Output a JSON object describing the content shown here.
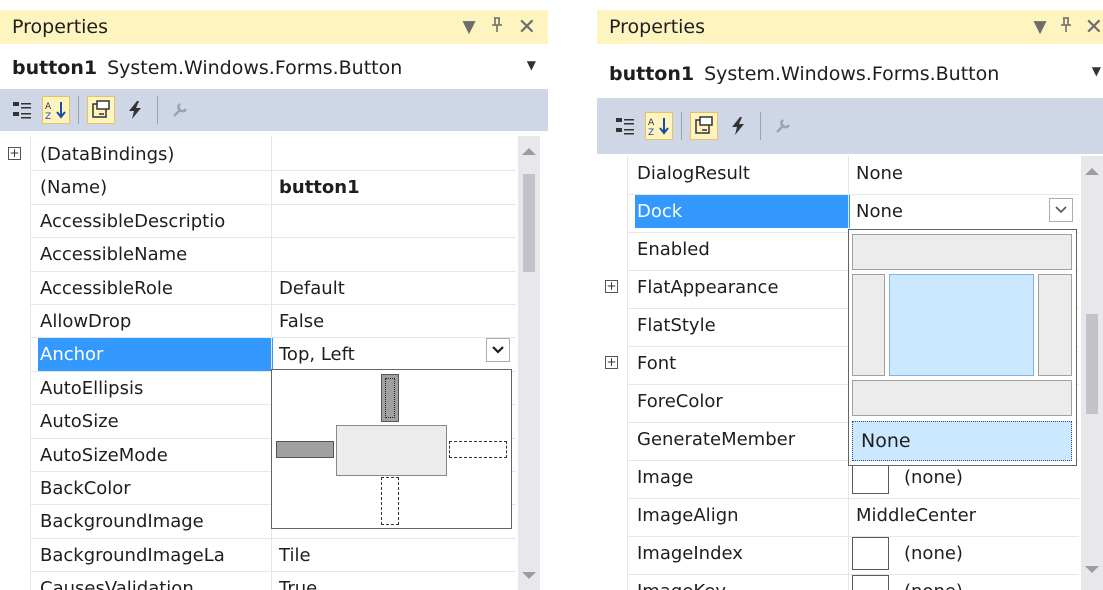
{
  "left_panel": {
    "title": "Properties",
    "object_name": "button1",
    "object_type": "System.Windows.Forms.Button",
    "rows": [
      {
        "name": "(DataBindings)",
        "value": "",
        "expandable": true
      },
      {
        "name": "(Name)",
        "value": "button1",
        "bold_value": true
      },
      {
        "name": "AccessibleDescriptio",
        "value": ""
      },
      {
        "name": "AccessibleName",
        "value": ""
      },
      {
        "name": "AccessibleRole",
        "value": "Default"
      },
      {
        "name": "AllowDrop",
        "value": "False"
      },
      {
        "name": "Anchor",
        "value": "Top, Left",
        "selected": true
      },
      {
        "name": "AutoEllipsis",
        "value": ""
      },
      {
        "name": "AutoSize",
        "value": ""
      },
      {
        "name": "AutoSizeMode",
        "value": ""
      },
      {
        "name": "BackColor",
        "value": ""
      },
      {
        "name": "BackgroundImage",
        "value": ""
      },
      {
        "name": "BackgroundImageLa",
        "value": "Tile"
      },
      {
        "name": "CausesValidation",
        "value": "True"
      }
    ]
  },
  "right_panel": {
    "title": "Properties",
    "object_name": "button1",
    "object_type": "System.Windows.Forms.Button",
    "rows": [
      {
        "name": "DialogResult",
        "value": "None"
      },
      {
        "name": "Dock",
        "value": "None",
        "selected": true
      },
      {
        "name": "Enabled",
        "value": ""
      },
      {
        "name": "FlatAppearance",
        "value": "",
        "expandable": true
      },
      {
        "name": "FlatStyle",
        "value": ""
      },
      {
        "name": "Font",
        "value": "",
        "expandable": true
      },
      {
        "name": "ForeColor",
        "value": ""
      },
      {
        "name": "GenerateMember",
        "value": ""
      },
      {
        "name": "Image",
        "value": "(none)",
        "swatch": true
      },
      {
        "name": "ImageAlign",
        "value": "MiddleCenter"
      },
      {
        "name": "ImageIndex",
        "value": "(none)",
        "swatch": true
      },
      {
        "name": "ImageKey",
        "value": "(none)",
        "swatch": true
      }
    ],
    "dock_editor": {
      "none_label": "None"
    }
  },
  "colors": {
    "title_bg": "#fdf4bf",
    "toolbar_bg": "#cfd6e5",
    "selection": "#3399ff",
    "dock_fill_selected": "#cce8ff"
  }
}
